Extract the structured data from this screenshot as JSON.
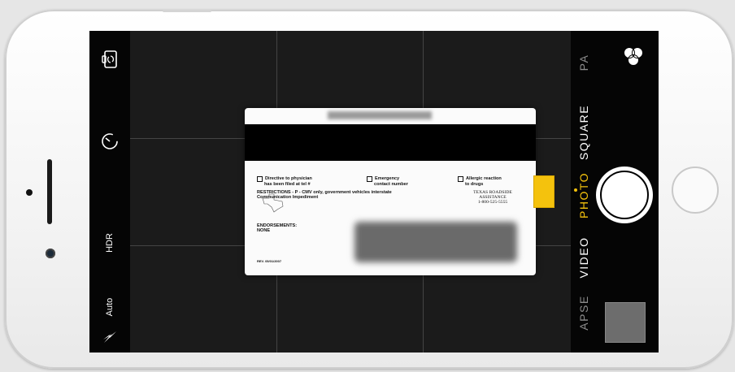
{
  "left_controls": {
    "hdr_label": "HDR",
    "flash_label": "Auto"
  },
  "camera_modes": {
    "items": [
      "LAPSE",
      "VIDEO",
      "PHOTO",
      "SQUARE",
      "PANO"
    ],
    "selected": "PHOTO",
    "lapse_visible": "APSE",
    "pano_visible": "PA"
  },
  "card": {
    "directive_line1": "Directive to physician",
    "directive_line2": "has been filed at tel #",
    "emergency_line1": "Emergency",
    "emergency_line2": "contact number",
    "allergic_line1": "Allergic reaction",
    "allergic_line2": "to drugs",
    "restrictions_line1": "RESTRICTIONS - P - CMV only, government vehicles interstate",
    "restrictions_line2": "Communication Impediment",
    "assist_line1": "TEXAS ROADSIDE",
    "assist_line2": "ASSISTANCE",
    "assist_phone": "1-800-525-5555",
    "endorsements_label": "ENDORSEMENTS:",
    "endorsements_value": "NONE",
    "rev": "REV. 05/01/2007"
  },
  "colors": {
    "accent_yellow": "#f4c20d",
    "screen_bg": "#000000",
    "viewfinder_bg": "#1b1b1b"
  },
  "icons": {
    "switch_camera": "switch-camera-icon",
    "timer": "timer-icon",
    "flash": "flash-icon",
    "filters": "filters-icon"
  }
}
